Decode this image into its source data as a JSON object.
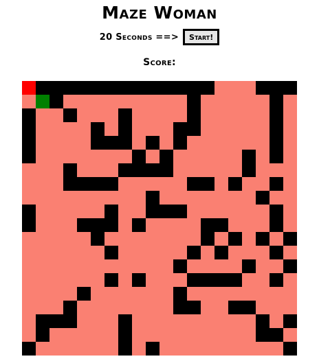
{
  "game": {
    "title": "Maze Woman",
    "timer_label": "20 Seconds ==>",
    "start_label": "Start!",
    "score_label": "Score:"
  },
  "maze": {
    "rows": 20,
    "cols": 20,
    "legend": {
      "W": "wall",
      ".": "path",
      "R": "player",
      "G": "goal"
    },
    "colors": {
      "wall": "#000000",
      "path": "#fa8072",
      "player": "#ff0000",
      "goal": "#008000"
    },
    "grid": [
      "RWWWWWWWWWWWWW...WWW",
      ".GW.........W.....W",
      "W..W...W....W.....W",
      "W....W.W...WW.....W",
      "W....WWW.W.W......W",
      "W.......W.W.....W.W",
      "...W...WWWW.....W..",
      "...WWWW.....WW.W..W",
      ".........W.......W..W",
      "W.....W..WWW......W",
      "W...WWW.W....WW...W.W",
      ".....W.......W.W.W.W",
      "......W.....W.W...W",
      "...........W....W..W",
      "......W.W...WWWW..W",
      "....W......W.......",
      "...W.......WW..WW...",
      ".WWW...W.........W.W",
      ".W.....W.........WW",
      "W......W.W.........W"
    ]
  }
}
